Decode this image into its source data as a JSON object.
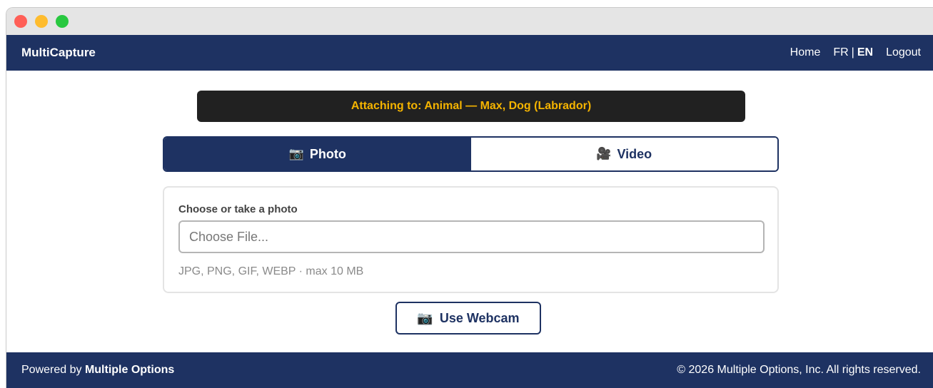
{
  "navbar": {
    "brand": "MultiCapture",
    "home": "Home",
    "lang_fr": "FR",
    "lang_sep": "|",
    "lang_en": "EN",
    "logout": "Logout"
  },
  "banner": {
    "text": "Attaching to: Animal — Max, Dog (Labrador)"
  },
  "tabs": [
    {
      "icon": "📷",
      "icon_name": "camera-icon",
      "label": "Photo",
      "active": true
    },
    {
      "icon": "🎥",
      "icon_name": "video-camera-icon",
      "label": "Video",
      "active": false
    }
  ],
  "upload": {
    "label": "Choose or take a photo",
    "placeholder": "Choose File...",
    "hint": "JPG, PNG, GIF, WEBP · max 10 MB"
  },
  "webcam": {
    "icon": "📷",
    "icon_name": "camera-icon",
    "label": "Use Webcam"
  },
  "footer": {
    "powered_prefix": "Powered by",
    "powered_brand": "Multiple Options",
    "copyright": "© 2026 Multiple Options, Inc. All rights reserved."
  },
  "colors": {
    "primary": "#1e3262",
    "banner_bg": "#212121",
    "banner_text": "#f5b400"
  }
}
